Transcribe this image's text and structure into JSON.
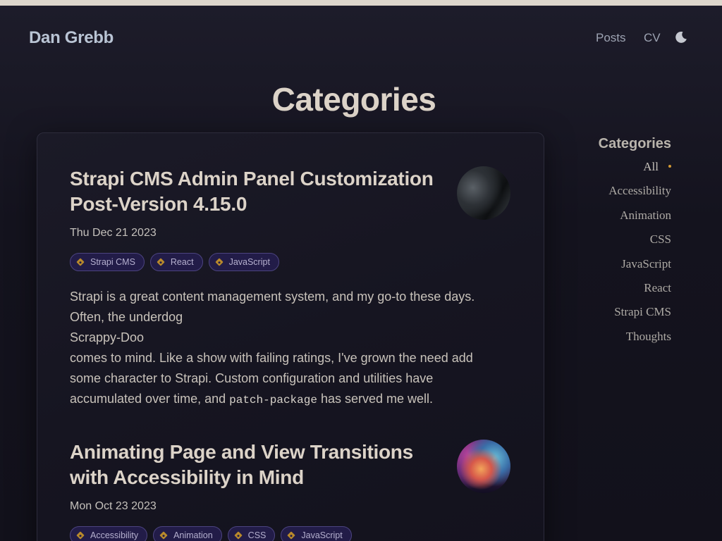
{
  "header": {
    "site_title": "Dan Grebb",
    "nav": [
      {
        "label": "Posts"
      },
      {
        "label": "CV"
      }
    ],
    "theme_toggle_icon": "moon-icon"
  },
  "page": {
    "title": "Categories"
  },
  "posts": [
    {
      "title": "Strapi CMS Admin Panel Customization Post-Version 4.15.0",
      "date": "Thu Dec 21 2023",
      "tags": [
        "Strapi CMS",
        "React",
        "JavaScript"
      ],
      "excerpt": {
        "line1": "Strapi is a great content management system, and my go-to these days. Often, the underdog",
        "line2": "Scrappy-Doo",
        "line3_before": "comes to mind. Like a show with failing ratings, I've grown the need add some character to Strapi. Custom configuration and utilities have accumulated over time, and ",
        "code": "patch-package",
        "line3_after": " has served me well."
      },
      "thumbnail_icon": "post-thumbnail-dark"
    },
    {
      "title": "Animating Page and View Transitions with Accessibility in Mind",
      "date": "Mon Oct 23 2023",
      "tags": [
        "Accessibility",
        "Animation",
        "CSS",
        "JavaScript"
      ],
      "thumbnail_icon": "post-thumbnail-nebula"
    }
  ],
  "sidebar": {
    "title": "Categories",
    "items": [
      {
        "label": "All"
      },
      {
        "label": "Accessibility"
      },
      {
        "label": "Animation"
      },
      {
        "label": "CSS"
      },
      {
        "label": "JavaScript"
      },
      {
        "label": "React"
      },
      {
        "label": "Strapi CMS"
      },
      {
        "label": "Thoughts"
      }
    ],
    "active_item": "All"
  },
  "colors": {
    "background": "#13121d",
    "tag_background": "#221c48",
    "tag_border": "#4c4480",
    "tag_icon": "#b8892c",
    "active_dot": "#d39a33"
  }
}
